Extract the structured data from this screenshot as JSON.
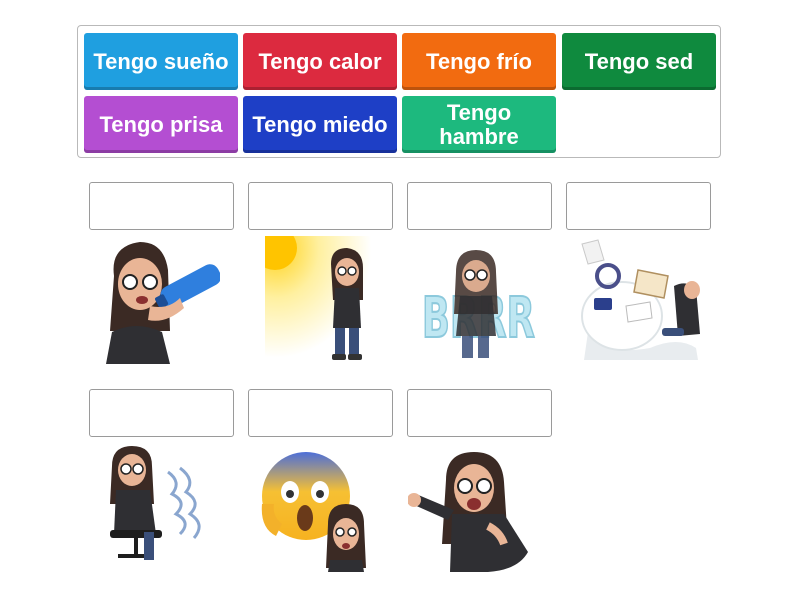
{
  "tiles": [
    {
      "label": "Tengo sueño",
      "color": "#1f9fe0"
    },
    {
      "label": "Tengo calor",
      "color": "#dc2a3f"
    },
    {
      "label": "Tengo frío",
      "color": "#f26b10"
    },
    {
      "label": "Tengo sed",
      "color": "#0f8a3e"
    },
    {
      "label": "Tengo prisa",
      "color": "#b44ed2"
    },
    {
      "label": "Tengo miedo",
      "color": "#1e3fc6"
    },
    {
      "label": "Tengo hambre",
      "color": "#1db97e"
    }
  ],
  "pictures": [
    {
      "icon": "drinking-water-avatar-icon",
      "text": ""
    },
    {
      "icon": "hot-sun-avatar-icon",
      "text": ""
    },
    {
      "icon": "cold-shivering-avatar-icon",
      "text": "BRRR"
    },
    {
      "icon": "hurrying-avatar-icon",
      "text": ""
    },
    {
      "icon": "scared-shaking-avatar-icon",
      "text": ""
    },
    {
      "icon": "screaming-emoji-avatar-icon",
      "text": ""
    },
    {
      "icon": "yawning-avatar-icon",
      "text": ""
    }
  ]
}
